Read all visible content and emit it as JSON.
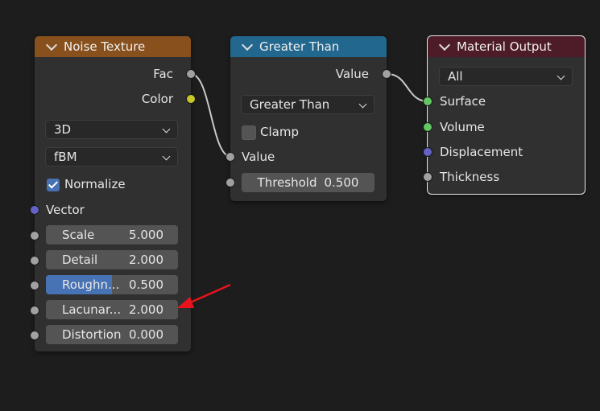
{
  "noise": {
    "title": "Noise Texture",
    "outputs": {
      "fac": "Fac",
      "color": "Color"
    },
    "dimension": "3D",
    "type": "fBM",
    "normalize_label": "Normalize",
    "normalize_checked": true,
    "vector_label": "Vector",
    "fields": [
      {
        "label": "Scale",
        "value": "5.000"
      },
      {
        "label": "Detail",
        "value": "2.000"
      },
      {
        "label": "Roughn...",
        "value": "0.500",
        "fill": 0.5
      },
      {
        "label": "Lacunar...",
        "value": "2.000"
      },
      {
        "label": "Distortion",
        "value": "0.000"
      }
    ]
  },
  "greater": {
    "title": "Greater Than",
    "output": "Value",
    "operation": "Greater Than",
    "clamp_label": "Clamp",
    "clamp_checked": false,
    "input_value": "Value",
    "threshold": {
      "label": "Threshold",
      "value": "0.500"
    }
  },
  "material": {
    "title": "Material Output",
    "target": "All",
    "inputs": [
      "Surface",
      "Volume",
      "Displacement",
      "Thickness"
    ]
  },
  "colors": {
    "noise_header": "#87501c",
    "greater_header": "#22678d",
    "material_header": "#4e1c28",
    "accent": "#4772b3",
    "arrow": "#e8131b"
  }
}
